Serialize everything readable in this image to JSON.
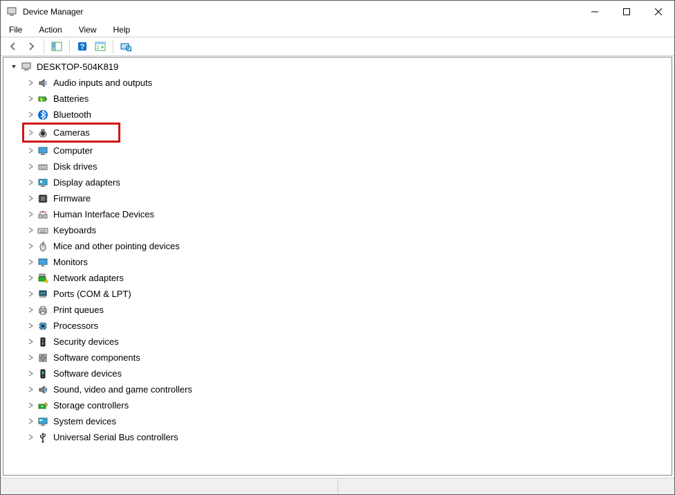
{
  "window": {
    "title": "Device Manager"
  },
  "menu": {
    "file": "File",
    "action": "Action",
    "view": "View",
    "help": "Help"
  },
  "toolbar": {
    "back": "back",
    "forward": "forward",
    "show_hide": "show-hide-tree",
    "help_btn": "help-button",
    "prop_btn": "properties-button",
    "scan_btn": "scan-hardware-button"
  },
  "tree": {
    "root": "DESKTOP-504K819",
    "root_expanded": true,
    "categories": [
      {
        "label": "Audio inputs and outputs",
        "icon": "speaker-icon",
        "highlighted": false
      },
      {
        "label": "Batteries",
        "icon": "battery-icon",
        "highlighted": false
      },
      {
        "label": "Bluetooth",
        "icon": "bluetooth-icon",
        "highlighted": false
      },
      {
        "label": "Cameras",
        "icon": "camera-icon",
        "highlighted": true
      },
      {
        "label": "Computer",
        "icon": "computer-icon",
        "highlighted": false
      },
      {
        "label": "Disk drives",
        "icon": "disk-icon",
        "highlighted": false
      },
      {
        "label": "Display adapters",
        "icon": "display-adapter-icon",
        "highlighted": false
      },
      {
        "label": "Firmware",
        "icon": "firmware-icon",
        "highlighted": false
      },
      {
        "label": "Human Interface Devices",
        "icon": "hid-icon",
        "highlighted": false
      },
      {
        "label": "Keyboards",
        "icon": "keyboard-icon",
        "highlighted": false
      },
      {
        "label": "Mice and other pointing devices",
        "icon": "mouse-icon",
        "highlighted": false
      },
      {
        "label": "Monitors",
        "icon": "monitor-icon",
        "highlighted": false
      },
      {
        "label": "Network adapters",
        "icon": "network-icon",
        "highlighted": false
      },
      {
        "label": "Ports (COM & LPT)",
        "icon": "port-icon",
        "highlighted": false
      },
      {
        "label": "Print queues",
        "icon": "printer-icon",
        "highlighted": false
      },
      {
        "label": "Processors",
        "icon": "processor-icon",
        "highlighted": false
      },
      {
        "label": "Security devices",
        "icon": "security-icon",
        "highlighted": false
      },
      {
        "label": "Software components",
        "icon": "software-component-icon",
        "highlighted": false
      },
      {
        "label": "Software devices",
        "icon": "software-device-icon",
        "highlighted": false
      },
      {
        "label": "Sound, video and game controllers",
        "icon": "sound-icon",
        "highlighted": false
      },
      {
        "label": "Storage controllers",
        "icon": "storage-icon",
        "highlighted": false
      },
      {
        "label": "System devices",
        "icon": "system-icon",
        "highlighted": false
      },
      {
        "label": "Universal Serial Bus controllers",
        "icon": "usb-icon",
        "highlighted": false
      }
    ]
  }
}
